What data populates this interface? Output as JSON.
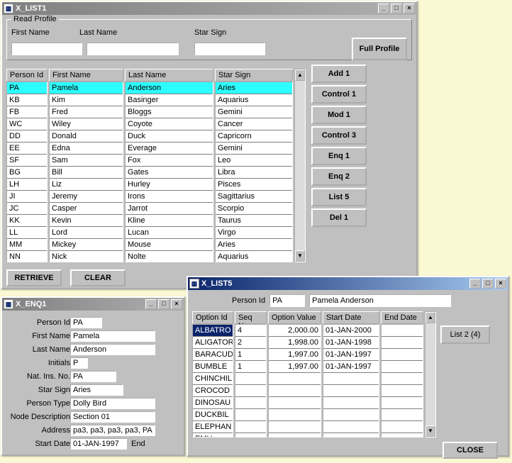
{
  "list1": {
    "title": "X_LIST1",
    "readProfile": {
      "legend": "Read Profile",
      "firstNameLabel": "First Name",
      "lastNameLabel": "Last Name",
      "starSignLabel": "Star Sign",
      "firstName": "",
      "lastName": "",
      "starSign": "",
      "fullProfileLabel": "Full Profile"
    },
    "gridHeaders": {
      "personId": "Person Id",
      "firstName": "First Name",
      "lastName": "Last Name",
      "starSign": "Star Sign"
    },
    "rows": [
      {
        "id": "PA",
        "fn": "Pamela",
        "ln": "Anderson",
        "ss": "Aries",
        "sel": true
      },
      {
        "id": "KB",
        "fn": "Kim",
        "ln": "Basinger",
        "ss": "Aquarius"
      },
      {
        "id": "FB",
        "fn": "Fred",
        "ln": "Bloggs",
        "ss": "Gemini"
      },
      {
        "id": "WC",
        "fn": "Wiley",
        "ln": "Coyote",
        "ss": "Cancer"
      },
      {
        "id": "DD",
        "fn": "Donald",
        "ln": "Duck",
        "ss": "Capricorn"
      },
      {
        "id": "EE",
        "fn": "Edna",
        "ln": "Everage",
        "ss": "Gemini"
      },
      {
        "id": "SF",
        "fn": "Sam",
        "ln": "Fox",
        "ss": "Leo"
      },
      {
        "id": "BG",
        "fn": "Bill",
        "ln": "Gates",
        "ss": "Libra"
      },
      {
        "id": "LH",
        "fn": "Liz",
        "ln": "Hurley",
        "ss": "Pisces"
      },
      {
        "id": "JI",
        "fn": "Jeremy",
        "ln": "Irons",
        "ss": "Sagittarius"
      },
      {
        "id": "JC",
        "fn": "Casper",
        "ln": "Jarrot",
        "ss": "Scorpio"
      },
      {
        "id": "KK",
        "fn": "Kevin",
        "ln": "Kline",
        "ss": "Taurus"
      },
      {
        "id": "LL",
        "fn": "Lord",
        "ln": "Lucan",
        "ss": "Virgo"
      },
      {
        "id": "MM",
        "fn": "Mickey",
        "ln": "Mouse",
        "ss": "Aries"
      },
      {
        "id": "NN",
        "fn": "Nick",
        "ln": "Nolte",
        "ss": "Aquarius"
      }
    ],
    "sideButtons": [
      "Add 1",
      "Control 1",
      "Mod 1",
      "Control 3",
      "Enq 1",
      "Enq 2",
      "List 5",
      "Del 1"
    ],
    "retrieveLabel": "RETRIEVE",
    "clearLabel": "CLEAR"
  },
  "enq1": {
    "title": "X_ENQ1",
    "fields": [
      {
        "label": "Person Id",
        "value": "PA",
        "w": 45
      },
      {
        "label": "First Name",
        "value": "Pamela",
        "w": 120
      },
      {
        "label": "Last Name",
        "value": "Anderson",
        "w": 120
      },
      {
        "label": "Initials",
        "value": "P",
        "w": 25
      },
      {
        "label": "Nat. Ins. No.",
        "value": "PA",
        "w": 65
      },
      {
        "label": "Star Sign",
        "value": "Aries",
        "w": 75
      },
      {
        "label": "Person Type",
        "value": "Dolly Bird",
        "w": 120
      },
      {
        "label": "Node Description",
        "value": "Section 01",
        "w": 120
      },
      {
        "label": "Address",
        "value": "pa3, pa3, pa3, pa3, PA",
        "w": 120
      },
      {
        "label": "Start Date",
        "value": "01-JAN-1997",
        "w": 80
      }
    ],
    "endLabel": "End"
  },
  "list5": {
    "title": "X_LIST5",
    "personIdLabel": "Person Id",
    "personId": "PA",
    "personName": "Pamela Anderson",
    "headers": [
      "Option Id",
      "Seq No",
      "Option Value",
      "Start Date",
      "End Date"
    ],
    "rows": [
      {
        "opt": "ALBATRO",
        "seq": "4",
        "val": "2,000.00",
        "sd": "01-JAN-2000",
        "ed": "",
        "sel": true
      },
      {
        "opt": "ALIGATOR",
        "seq": "2",
        "val": "1,998.00",
        "sd": "01-JAN-1998",
        "ed": ""
      },
      {
        "opt": "BARACUD",
        "seq": "1",
        "val": "1,997.00",
        "sd": "01-JAN-1997",
        "ed": ""
      },
      {
        "opt": "BUMBLE",
        "seq": "1",
        "val": "1,997.00",
        "sd": "01-JAN-1997",
        "ed": ""
      },
      {
        "opt": "CHINCHIL",
        "seq": "",
        "val": "",
        "sd": "",
        "ed": ""
      },
      {
        "opt": "CROCOD",
        "seq": "",
        "val": "",
        "sd": "",
        "ed": ""
      },
      {
        "opt": "DINOSAU",
        "seq": "",
        "val": "",
        "sd": "",
        "ed": ""
      },
      {
        "opt": "DUCKBIL",
        "seq": "",
        "val": "",
        "sd": "",
        "ed": ""
      },
      {
        "opt": "ELEPHAN",
        "seq": "",
        "val": "",
        "sd": "",
        "ed": ""
      },
      {
        "opt": "EMU",
        "seq": "",
        "val": "",
        "sd": "",
        "ed": ""
      }
    ],
    "list2Label": "List 2 (4)",
    "closeLabel": "CLOSE"
  }
}
